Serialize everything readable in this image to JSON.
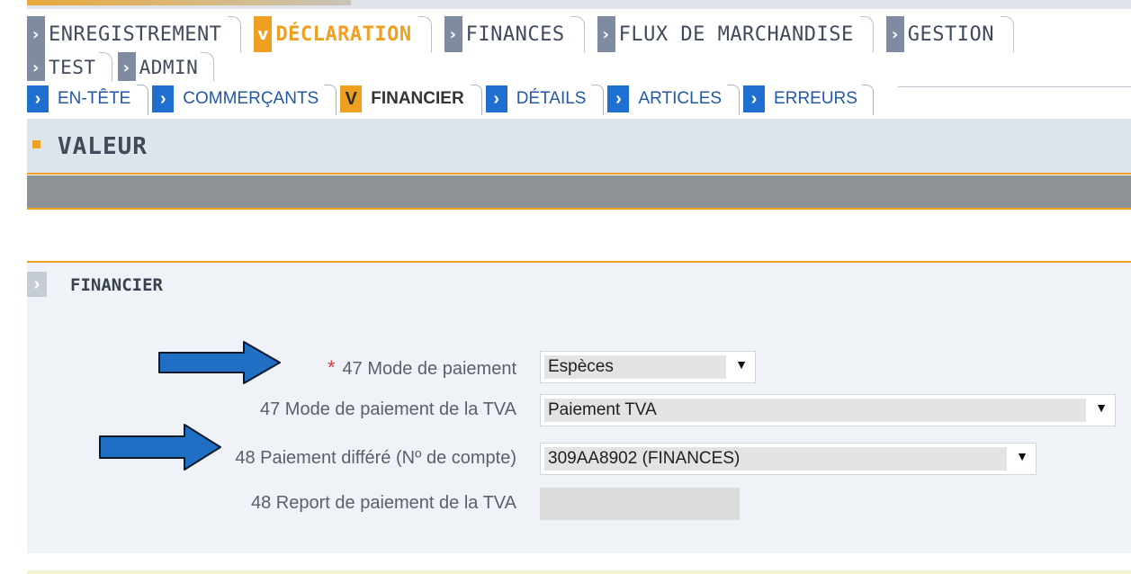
{
  "main_tabs": {
    "row1": [
      {
        "label": "ENREGISTREMENT",
        "active": false
      },
      {
        "label": "DÉCLARATION",
        "active": true
      },
      {
        "label": "FINANCES",
        "active": false
      },
      {
        "label": "FLUX DE MARCHANDISE",
        "active": false
      },
      {
        "label": "GESTION",
        "active": false
      }
    ],
    "row2": [
      {
        "label": "TEST",
        "active": false
      },
      {
        "label": "ADMIN",
        "active": false
      }
    ]
  },
  "sub_tabs": [
    {
      "label": "EN-TÊTE",
      "active": false
    },
    {
      "label": "COMMERÇANTS",
      "active": false
    },
    {
      "label": "FINANCIER",
      "active": true
    },
    {
      "label": "DÉTAILS",
      "active": false
    },
    {
      "label": "ARTICLES",
      "active": false
    },
    {
      "label": "ERREURS",
      "active": false
    }
  ],
  "page_title": "VALEUR",
  "section": {
    "title": "FINANCIER",
    "fields": [
      {
        "label": "47 Mode de paiement",
        "required": true,
        "value": "Espèces",
        "type": "select"
      },
      {
        "label": "47 Mode de paiement de la TVA",
        "required": false,
        "value": "Paiement TVA",
        "type": "select"
      },
      {
        "label": "48 Paiement différé (Nº de compte)",
        "required": false,
        "value": "309AA8902 (FINANCES)",
        "type": "select"
      },
      {
        "label": "48 Report de paiement de la TVA",
        "required": false,
        "value": "",
        "type": "readonly"
      }
    ]
  },
  "icons": {
    "tab_chevron": "chevron-right-icon",
    "active_chevron": "chevron-down-icon",
    "dropdown": "caret-down-icon",
    "annotation_arrow": "arrow-right-icon"
  },
  "colors": {
    "accent": "#f0a020",
    "tab_blue": "#1f6fd1",
    "annotation_arrow": "#1f6fc4"
  }
}
